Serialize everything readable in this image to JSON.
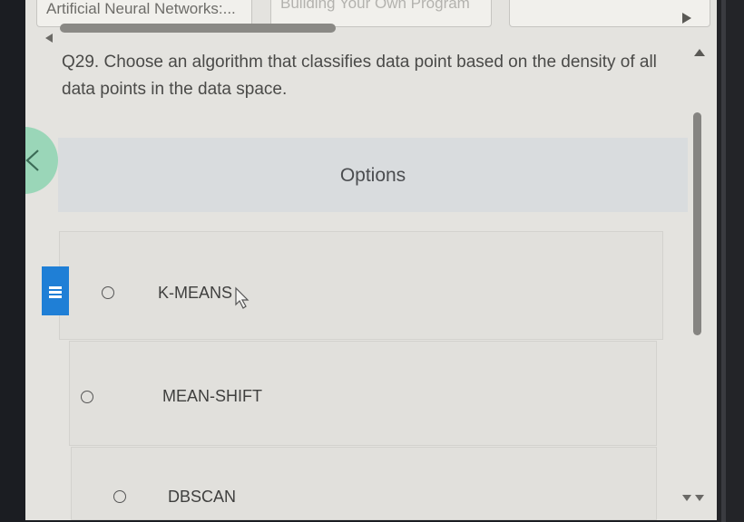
{
  "tabs": [
    {
      "label": "Artificial Neural Networks:..."
    },
    {
      "label": "Building Your Own Program"
    },
    {
      "label": ""
    }
  ],
  "question": {
    "text": "Q29. Choose an algorithm that classifies data point based on the density of all data points in the data space."
  },
  "options": {
    "title": "Options",
    "items": [
      {
        "label": "K-MEANS",
        "selected": false
      },
      {
        "label": "MEAN-SHIFT",
        "selected": false
      },
      {
        "label": "DBSCAN",
        "selected": false
      }
    ]
  },
  "icons": {
    "prev": "chevron-left-icon",
    "menu": "hamburger-menu-icon",
    "cursor": "mouse-cursor-icon"
  },
  "colors": {
    "accent_blue": "#1f7fd6",
    "nav_green": "#9ad6b8",
    "page_bg": "#e4e3df"
  }
}
